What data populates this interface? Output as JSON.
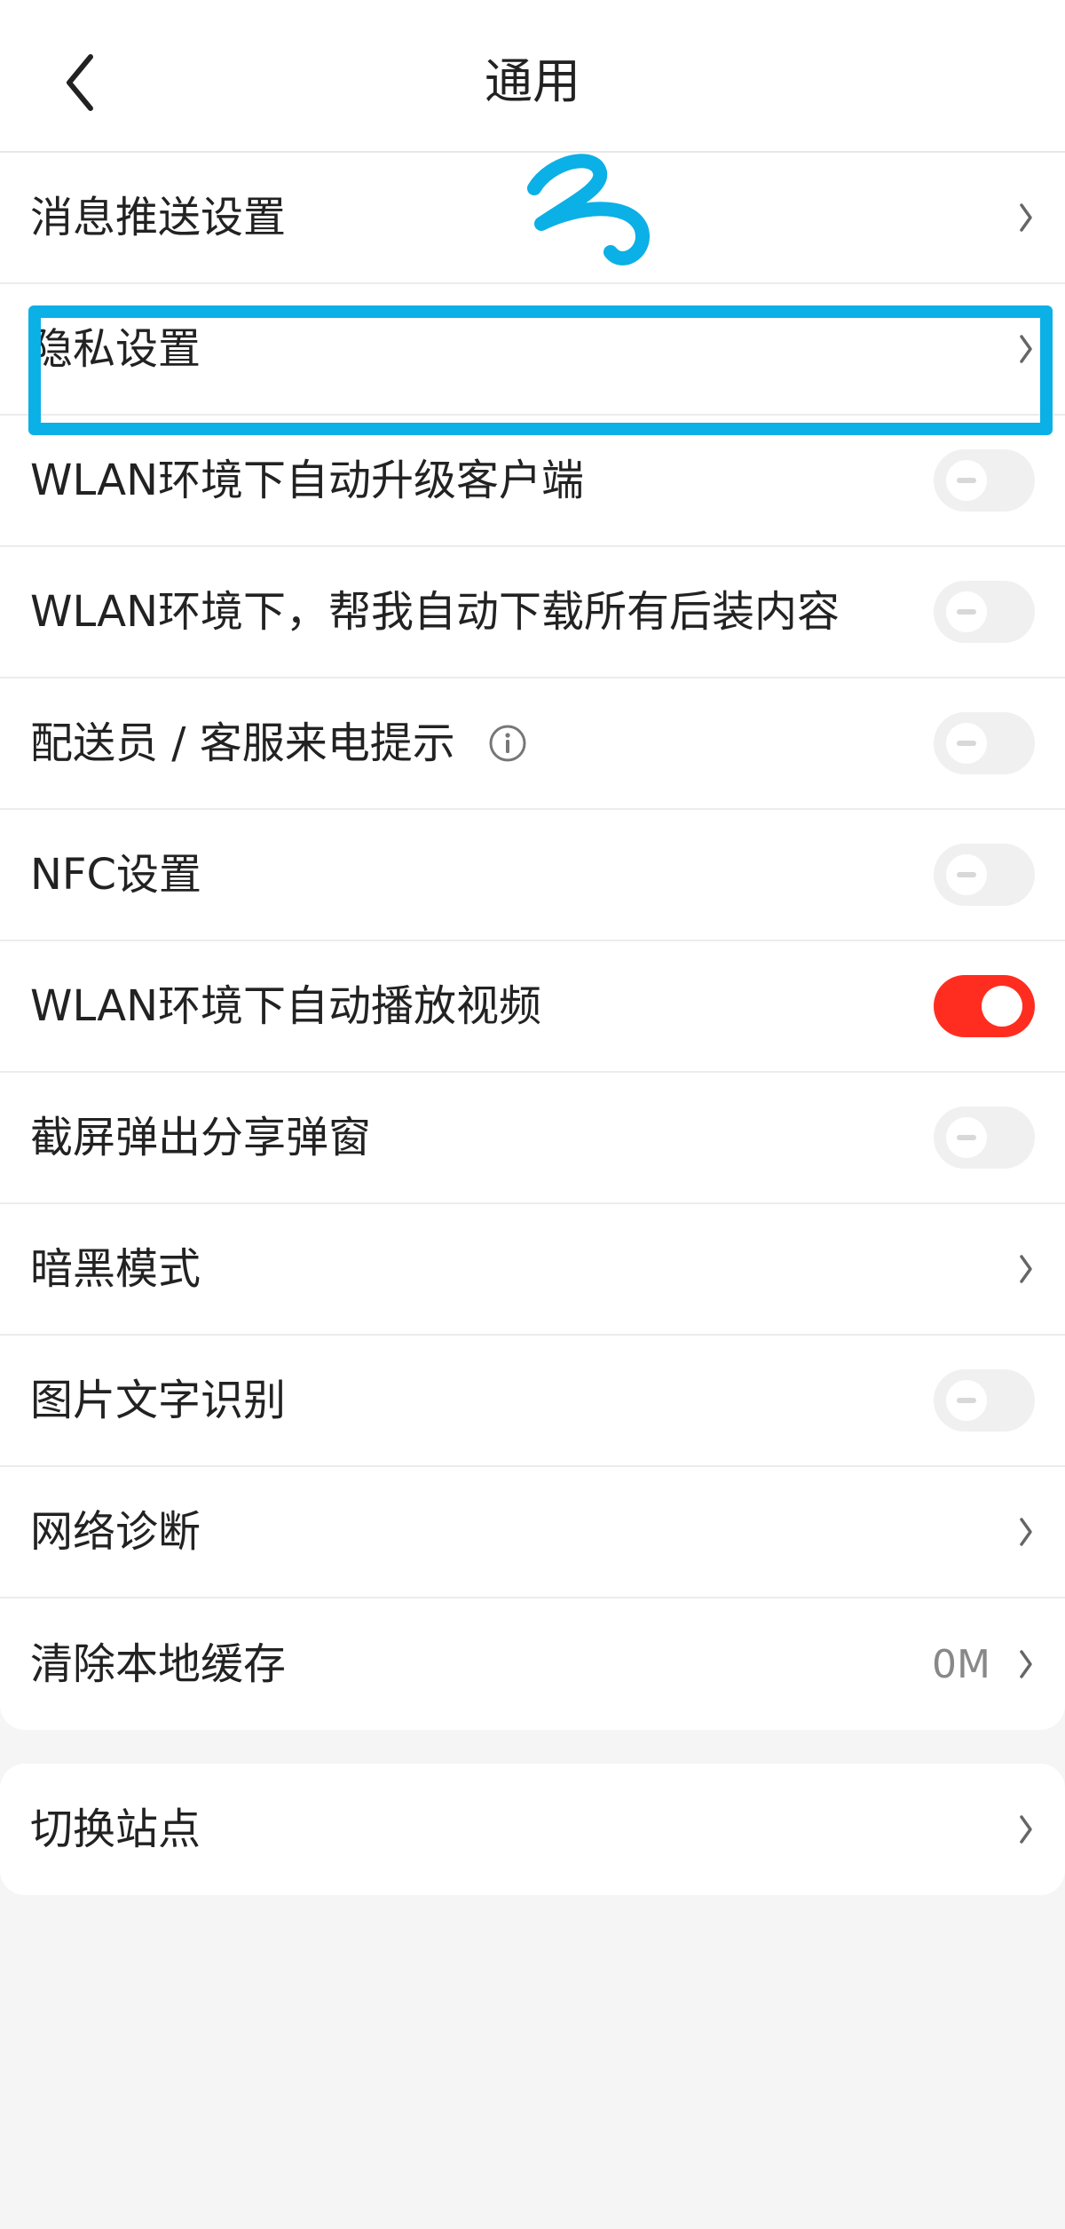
{
  "header": {
    "title": "通用",
    "back_icon": "chevron-left-icon"
  },
  "settings": [
    {
      "id": "push",
      "label": "消息推送设置",
      "control": "chevron"
    },
    {
      "id": "privacy",
      "label": "隐私设置",
      "control": "chevron"
    },
    {
      "id": "auto-upgrade",
      "label": "WLAN环境下自动升级客户端",
      "control": "toggle",
      "on": false
    },
    {
      "id": "auto-download",
      "label": "WLAN环境下，帮我自动下载所有后装内容",
      "control": "toggle",
      "on": false
    },
    {
      "id": "courier-call",
      "label": "配送员 / 客服来电提示",
      "control": "toggle",
      "on": false,
      "info_icon": "info-circle-icon"
    },
    {
      "id": "nfc",
      "label": "NFC设置",
      "control": "toggle",
      "on": false
    },
    {
      "id": "autoplay",
      "label": "WLAN环境下自动播放视频",
      "control": "toggle",
      "on": true
    },
    {
      "id": "screenshot-share",
      "label": "截屏弹出分享弹窗",
      "control": "toggle",
      "on": false
    },
    {
      "id": "dark-mode",
      "label": "暗黑模式",
      "control": "chevron"
    },
    {
      "id": "image-ocr",
      "label": "图片文字识别",
      "control": "toggle",
      "on": false
    },
    {
      "id": "network-diagnosis",
      "label": "网络诊断",
      "control": "chevron"
    },
    {
      "id": "clear-cache",
      "label": "清除本地缓存",
      "control": "chevron",
      "value": "0M"
    }
  ],
  "settings_2": [
    {
      "id": "switch-site",
      "label": "切换站点",
      "control": "chevron"
    }
  ],
  "colors": {
    "accent_on": "#ff2d20",
    "highlight": "#0bb0e6",
    "background": "#f5f5f5"
  }
}
